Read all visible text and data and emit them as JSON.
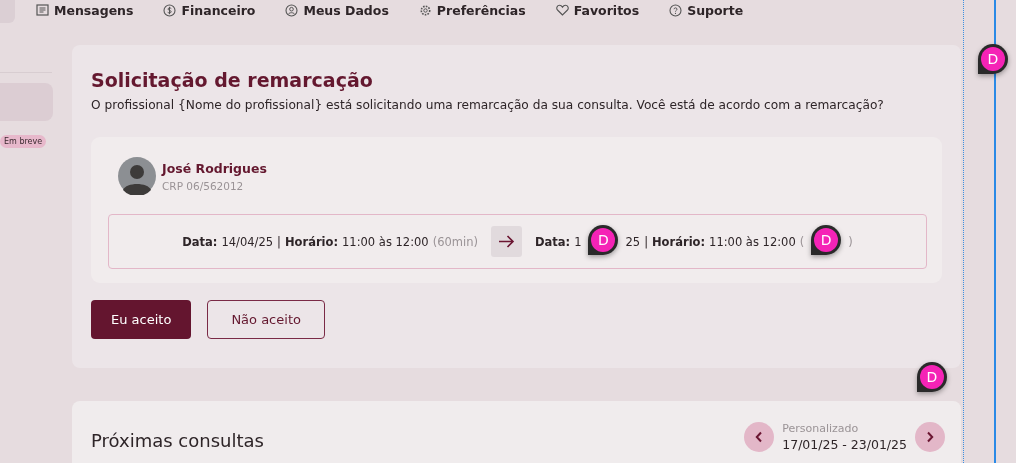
{
  "nav": [
    {
      "label": "Mensagens"
    },
    {
      "label": "Financeiro"
    },
    {
      "label": "Meus Dados"
    },
    {
      "label": "Preferências"
    },
    {
      "label": "Favoritos"
    },
    {
      "label": "Suporte"
    }
  ],
  "sidebar": {
    "badge": "Em breve"
  },
  "request": {
    "title": "Solicitação de remarcação",
    "message": "O profissional {Nome do profissional} está solicitando uma remarcação da sua consulta. Você está de acordo com a remarcação?",
    "professional": {
      "name": "José Rodrigues",
      "registry": "CRP 06/562012"
    },
    "current": {
      "date_label": "Data:",
      "date": "14/04/25",
      "separator": "|",
      "time_label": "Horário:",
      "time": "11:00 às 12:00",
      "duration": "(60min)"
    },
    "proposed": {
      "date_label": "Data:",
      "date_parts": [
        "1",
        "25"
      ],
      "separator": "|",
      "time_label": "Horário:",
      "time": "11:00 às 12:00",
      "duration_parts": [
        "(",
        ")"
      ]
    },
    "buttons": [
      {
        "label": "Eu aceito",
        "kind": "primary"
      },
      {
        "label": "Não aceito",
        "kind": "secondary"
      }
    ]
  },
  "upcoming": {
    "title": "Próximas consultas",
    "range_label": "Personalizado",
    "range": "17/01/25 - 23/01/25"
  },
  "comment_pins": [
    {
      "label": "D"
    },
    {
      "label": "D"
    },
    {
      "label": "D"
    },
    {
      "label": "D"
    }
  ]
}
